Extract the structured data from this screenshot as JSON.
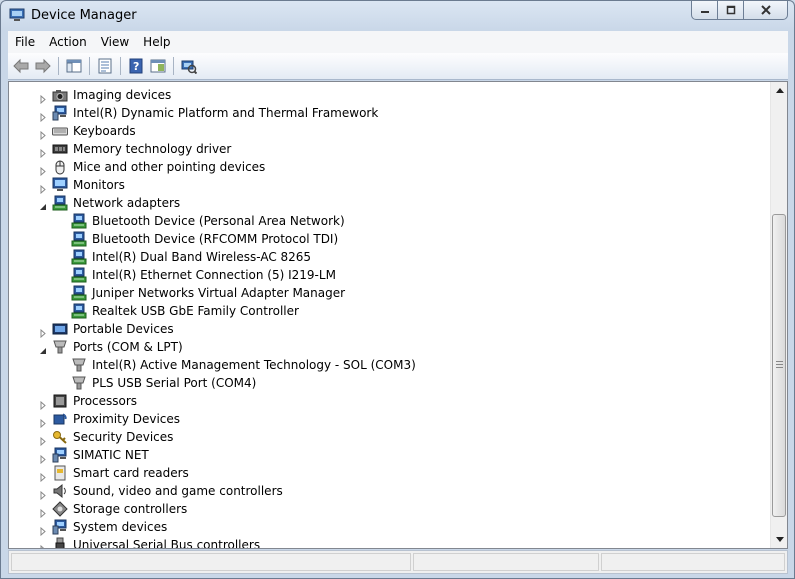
{
  "window": {
    "title": "Device Manager"
  },
  "menu": [
    {
      "label": "File"
    },
    {
      "label": "Action"
    },
    {
      "label": "View"
    },
    {
      "label": "Help"
    }
  ],
  "toolbar": [
    {
      "name": "back-button",
      "icon": "arrow-left-icon"
    },
    {
      "name": "forward-button",
      "icon": "arrow-right-icon"
    },
    {
      "name": "show-hide-console-tree-button",
      "icon": "console-tree-icon"
    },
    {
      "name": "properties-button",
      "icon": "properties-icon"
    },
    {
      "name": "help-button",
      "icon": "help-icon"
    },
    {
      "name": "update-driver-button",
      "icon": "update-driver-icon"
    },
    {
      "name": "scan-hardware-changes-button",
      "icon": "scan-hardware-icon"
    }
  ],
  "tree": [
    {
      "label": "Imaging devices",
      "icon": "camera-icon",
      "level": 0,
      "state": "collapsed"
    },
    {
      "label": "Intel(R) Dynamic Platform and Thermal Framework",
      "icon": "computer-icon",
      "level": 0,
      "state": "collapsed"
    },
    {
      "label": "Keyboards",
      "icon": "keyboard-icon",
      "level": 0,
      "state": "collapsed"
    },
    {
      "label": "Memory technology driver",
      "icon": "memory-icon",
      "level": 0,
      "state": "collapsed"
    },
    {
      "label": "Mice and other pointing devices",
      "icon": "mouse-icon",
      "level": 0,
      "state": "collapsed"
    },
    {
      "label": "Monitors",
      "icon": "monitor-icon",
      "level": 0,
      "state": "collapsed"
    },
    {
      "label": "Network adapters",
      "icon": "network-adapter-icon",
      "level": 0,
      "state": "expanded"
    },
    {
      "label": "Bluetooth Device (Personal Area Network)",
      "icon": "network-adapter-icon",
      "level": 1
    },
    {
      "label": "Bluetooth Device (RFCOMM Protocol TDI)",
      "icon": "network-adapter-icon",
      "level": 1
    },
    {
      "label": "Intel(R) Dual Band Wireless-AC 8265",
      "icon": "network-adapter-icon",
      "level": 1
    },
    {
      "label": "Intel(R) Ethernet Connection (5) I219-LM",
      "icon": "network-adapter-icon",
      "level": 1
    },
    {
      "label": "Juniper Networks Virtual Adapter Manager",
      "icon": "network-adapter-icon",
      "level": 1
    },
    {
      "label": "Realtek USB GbE Family Controller",
      "icon": "network-adapter-icon",
      "level": 1
    },
    {
      "label": "Portable Devices",
      "icon": "portable-device-icon",
      "level": 0,
      "state": "collapsed"
    },
    {
      "label": "Ports (COM & LPT)",
      "icon": "port-icon",
      "level": 0,
      "state": "expanded"
    },
    {
      "label": "Intel(R) Active Management Technology - SOL (COM3)",
      "icon": "port-icon",
      "level": 1
    },
    {
      "label": "PLS USB Serial Port (COM4)",
      "icon": "port-icon",
      "level": 1
    },
    {
      "label": "Processors",
      "icon": "processor-icon",
      "level": 0,
      "state": "collapsed"
    },
    {
      "label": "Proximity Devices",
      "icon": "proximity-icon",
      "level": 0,
      "state": "collapsed"
    },
    {
      "label": "Security Devices",
      "icon": "security-key-icon",
      "level": 0,
      "state": "collapsed"
    },
    {
      "label": "SIMATIC NET",
      "icon": "computer-icon",
      "level": 0,
      "state": "collapsed"
    },
    {
      "label": "Smart card readers",
      "icon": "smart-card-icon",
      "level": 0,
      "state": "collapsed"
    },
    {
      "label": "Sound, video and game controllers",
      "icon": "speaker-icon",
      "level": 0,
      "state": "collapsed"
    },
    {
      "label": "Storage controllers",
      "icon": "storage-icon",
      "level": 0,
      "state": "collapsed"
    },
    {
      "label": "System devices",
      "icon": "computer-icon",
      "level": 0,
      "state": "collapsed"
    },
    {
      "label": "Universal Serial Bus controllers",
      "icon": "usb-icon",
      "level": 0,
      "state": "collapsed"
    }
  ]
}
